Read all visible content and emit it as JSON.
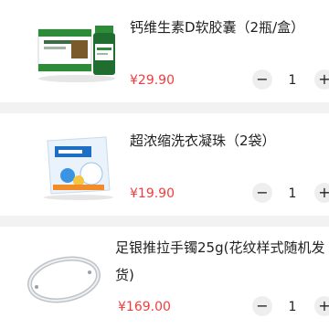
{
  "cart": {
    "items": [
      {
        "title": "钙维生素D软胶囊（2瓶/盒）",
        "price": "¥29.90",
        "quantity": "1",
        "minus_label": "−",
        "plus_label": "+",
        "image_icon": "vitamin-box-icon"
      },
      {
        "title": "超浓缩洗衣凝珠（2袋）",
        "price": "¥19.90",
        "quantity": "1",
        "minus_label": "−",
        "plus_label": "+",
        "image_icon": "detergent-bag-icon"
      },
      {
        "title": "足银推拉手镯25g(花纹样式随机发货)",
        "price": "¥169.00",
        "quantity": "1",
        "minus_label": "−",
        "plus_label": "+",
        "image_icon": "silver-bracelet-icon"
      }
    ]
  },
  "colors": {
    "price": "#f23c3c",
    "background": "#f2f2f2",
    "card": "#ffffff",
    "brand_green": "#2e8b3a"
  }
}
